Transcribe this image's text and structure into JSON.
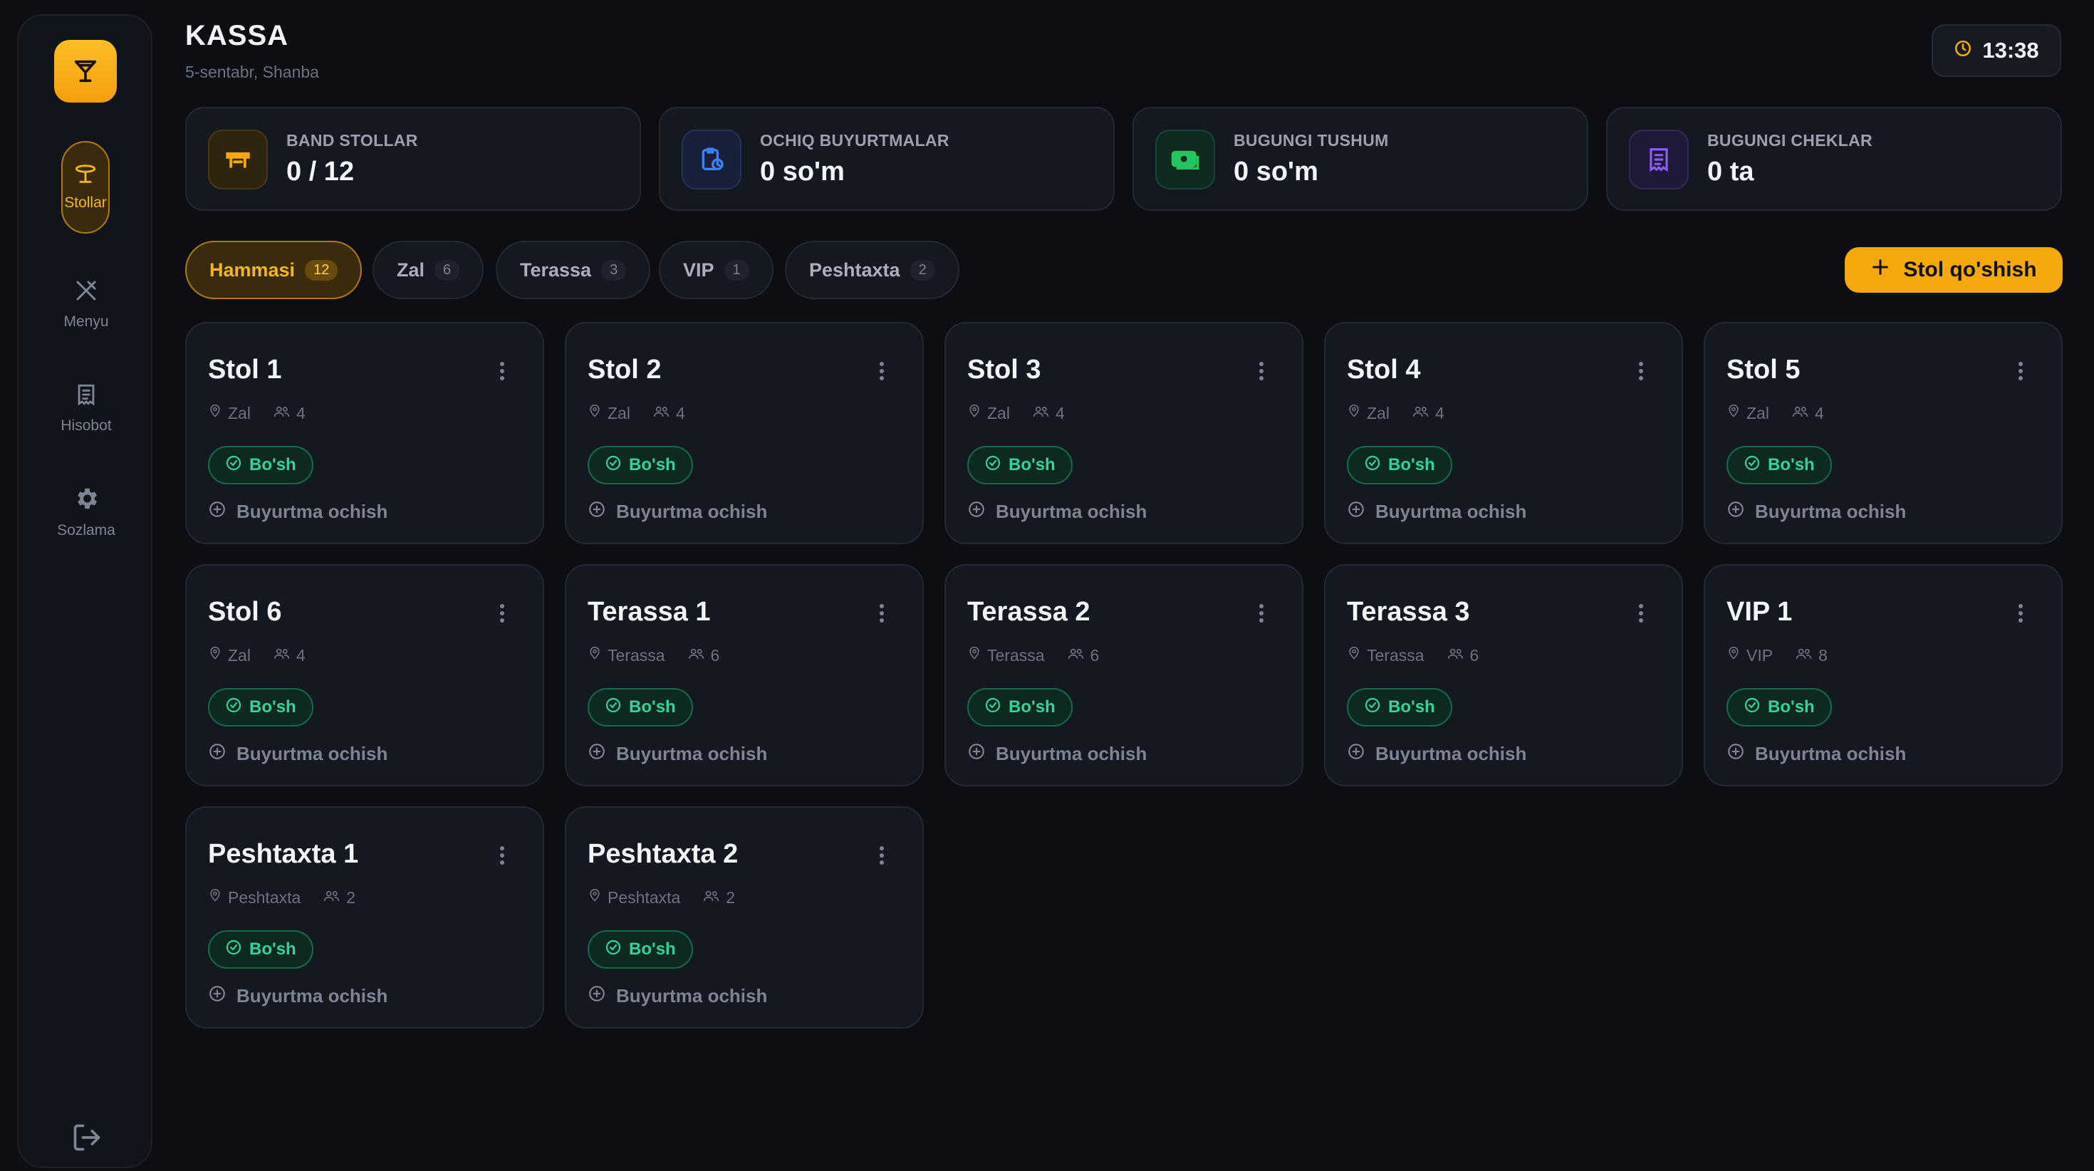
{
  "header": {
    "title": "KASSA",
    "date": "5-sentabr, Shanba",
    "time": "13:38"
  },
  "sidebar": {
    "items": [
      {
        "label": "Stollar",
        "icon": "table-icon",
        "active": true
      },
      {
        "label": "Menyu",
        "icon": "utensils-icon",
        "active": false
      },
      {
        "label": "Hisobot",
        "icon": "receipt-icon",
        "active": false
      },
      {
        "label": "Sozlama",
        "icon": "gear-icon",
        "active": false
      }
    ]
  },
  "stats": [
    {
      "label": "BAND STOLLAR",
      "value": "0 / 12",
      "icon": "table-icon",
      "color": "#f5a80a"
    },
    {
      "label": "OCHIQ BUYURTMALAR",
      "value": "0 so'm",
      "icon": "clipboard-clock-icon",
      "color": "#3b82f6"
    },
    {
      "label": "BUGUNGI TUSHUM",
      "value": "0 so'm",
      "icon": "cash-icon",
      "color": "#22c55e"
    },
    {
      "label": "BUGUNGI CHEKLAR",
      "value": "0 ta",
      "icon": "receipt-icon",
      "color": "#8b5cf6"
    }
  ],
  "filters": [
    {
      "label": "Hammasi",
      "count": "12",
      "active": true
    },
    {
      "label": "Zal",
      "count": "6",
      "active": false
    },
    {
      "label": "Terassa",
      "count": "3",
      "active": false
    },
    {
      "label": "VIP",
      "count": "1",
      "active": false
    },
    {
      "label": "Peshtaxta",
      "count": "2",
      "active": false
    }
  ],
  "add_button": {
    "label": "Stol qo'shish"
  },
  "tables": [
    {
      "name": "Stol 1",
      "zone": "Zal",
      "seats": "4",
      "status": "Bo'sh",
      "action": "Buyurtma ochish"
    },
    {
      "name": "Stol 2",
      "zone": "Zal",
      "seats": "4",
      "status": "Bo'sh",
      "action": "Buyurtma ochish"
    },
    {
      "name": "Stol 3",
      "zone": "Zal",
      "seats": "4",
      "status": "Bo'sh",
      "action": "Buyurtma ochish"
    },
    {
      "name": "Stol 4",
      "zone": "Zal",
      "seats": "4",
      "status": "Bo'sh",
      "action": "Buyurtma ochish"
    },
    {
      "name": "Stol 5",
      "zone": "Zal",
      "seats": "4",
      "status": "Bo'sh",
      "action": "Buyurtma ochish"
    },
    {
      "name": "Stol 6",
      "zone": "Zal",
      "seats": "4",
      "status": "Bo'sh",
      "action": "Buyurtma ochish"
    },
    {
      "name": "Terassa 1",
      "zone": "Terassa",
      "seats": "6",
      "status": "Bo'sh",
      "action": "Buyurtma ochish"
    },
    {
      "name": "Terassa 2",
      "zone": "Terassa",
      "seats": "6",
      "status": "Bo'sh",
      "action": "Buyurtma ochish"
    },
    {
      "name": "Terassa 3",
      "zone": "Terassa",
      "seats": "6",
      "status": "Bo'sh",
      "action": "Buyurtma ochish"
    },
    {
      "name": "VIP 1",
      "zone": "VIP",
      "seats": "8",
      "status": "Bo'sh",
      "action": "Buyurtma ochish"
    },
    {
      "name": "Peshtaxta 1",
      "zone": "Peshtaxta",
      "seats": "2",
      "status": "Bo'sh",
      "action": "Buyurtma ochish"
    },
    {
      "name": "Peshtaxta 2",
      "zone": "Peshtaxta",
      "seats": "2",
      "status": "Bo'sh",
      "action": "Buyurtma ochish"
    }
  ]
}
